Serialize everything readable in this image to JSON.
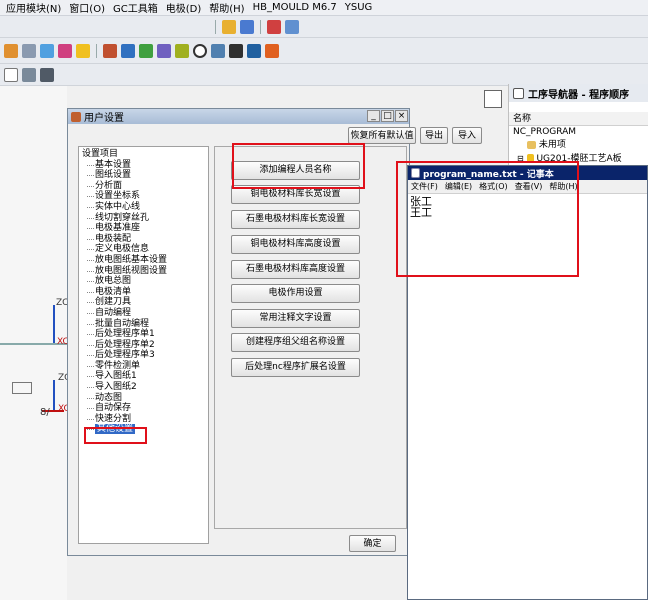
{
  "menubar": {
    "items": [
      "应用模块(N)",
      "窗口(O)",
      "GC工具箱",
      "电极(D)",
      "帮助(H)",
      "HB_MOULD M6.7",
      "YSUG"
    ]
  },
  "viewport": {
    "axis_labels": {
      "z_top": "ZC",
      "x_mid": "XC",
      "z_low": "ZC",
      "x_low": "XC",
      "bottom_left": "8/"
    }
  },
  "dialog": {
    "title": "用户设置",
    "window_buttons": [
      "_",
      "□",
      "×"
    ],
    "top_buttons": {
      "restore_defaults": "恢复所有默认值",
      "export": "导出",
      "import": "导入"
    },
    "tree": {
      "root": "设置项目",
      "items": [
        "基本设置",
        "图纸设置",
        "分析面",
        "设置坐标系",
        "实体中心线",
        "线切割穿丝孔",
        "电极基准座",
        "电极装配",
        "定义电极信息",
        "放电图纸基本设置",
        "放电图纸视图设置",
        "放电总图",
        "电极清单",
        "创建刀具",
        "自动编程",
        "批量自动编程",
        "后处理程序单1",
        "后处理程序单2",
        "后处理程序单3",
        "零件检测单",
        "导入图纸1",
        "导入图纸2",
        "动态图",
        "自动保存",
        "快速分割",
        "其他设置"
      ],
      "selected_index": 25
    },
    "action_buttons": [
      "添加编程人员名称",
      "铜电极材料库长宽设置",
      "石墨电极材料库长宽设置",
      "铜电极材料库高度设置",
      "石墨电极材料库高度设置",
      "电极作用设置",
      "常用注释文字设置",
      "创建程序组父组名称设置",
      "后处理nc程序扩展名设置"
    ],
    "ok_button": "确定"
  },
  "navigator": {
    "title": "工序导航器 - 程序顺序",
    "column": "名称",
    "rows": [
      "NC_PROGRAM",
      "未用项",
      "UG201-模胚工艺A板"
    ]
  },
  "notepad": {
    "title": "program_name.txt - 记事本",
    "menu": [
      "文件(F)",
      "编辑(E)",
      "格式(O)",
      "查看(V)",
      "帮助(H)"
    ],
    "lines": [
      "张工",
      "王工"
    ]
  },
  "colors": {
    "highlight_box": "#e0101a",
    "selection": "#3169c6",
    "notepad_title": "#0a246a"
  }
}
